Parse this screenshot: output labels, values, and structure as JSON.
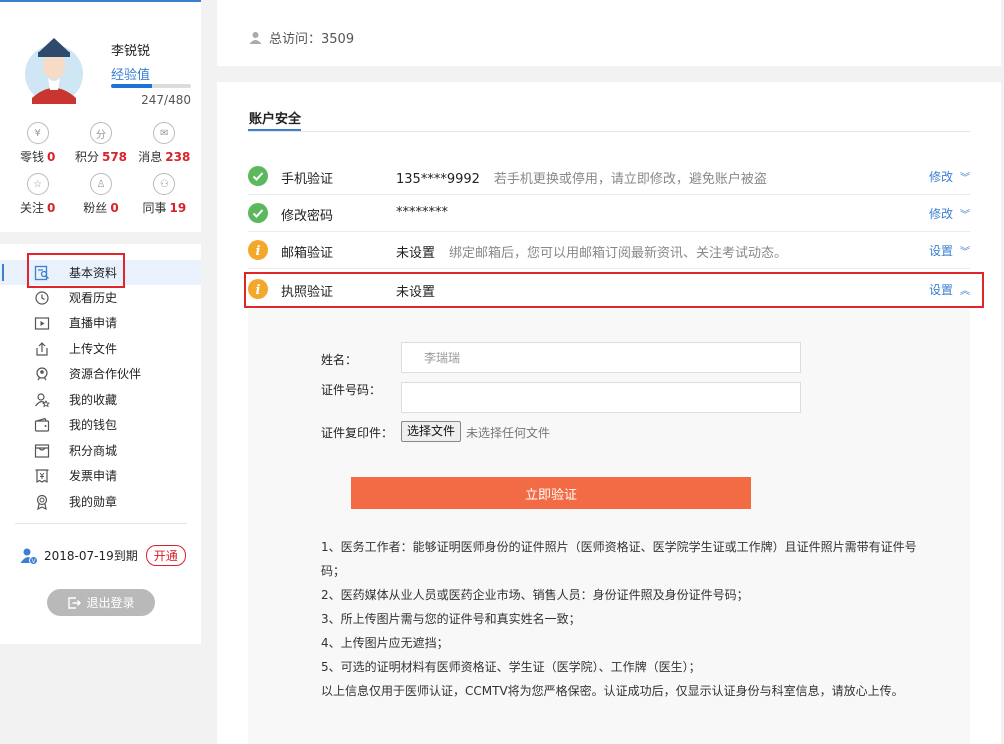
{
  "profile": {
    "name": "李锐锐",
    "exp_label": "经验值",
    "exp_current": 247,
    "exp_max": 480,
    "exp_text": "247/480",
    "stats": [
      {
        "label": "零钱",
        "value": "0",
        "icon": "coin-icon"
      },
      {
        "label": "积分",
        "value": "578",
        "icon": "points-icon"
      },
      {
        "label": "消息",
        "value": "238",
        "icon": "mail-icon"
      },
      {
        "label": "关注",
        "value": "0",
        "icon": "star-icon"
      },
      {
        "label": "粉丝",
        "value": "0",
        "icon": "fans-icon"
      },
      {
        "label": "同事",
        "value": "19",
        "icon": "colleagues-icon"
      }
    ]
  },
  "menu": {
    "items": [
      {
        "label": "基本资料",
        "icon": "profile-card-icon",
        "active": true
      },
      {
        "label": "观看历史",
        "icon": "history-icon"
      },
      {
        "label": "直播申请",
        "icon": "live-icon"
      },
      {
        "label": "上传文件",
        "icon": "upload-icon"
      },
      {
        "label": "资源合作伙伴",
        "icon": "partner-icon"
      },
      {
        "label": "我的收藏",
        "icon": "favorite-icon"
      },
      {
        "label": "我的钱包",
        "icon": "wallet-icon"
      },
      {
        "label": "积分商城",
        "icon": "shop-icon"
      },
      {
        "label": "发票申请",
        "icon": "invoice-icon"
      },
      {
        "label": "我的勋章",
        "icon": "medal-icon"
      }
    ],
    "expire_text": "2018-07-19到期",
    "open_label": "开通",
    "logout_label": "退出登录"
  },
  "visits": {
    "text": "总访问：3509"
  },
  "security": {
    "title": "账户安全",
    "rows": [
      {
        "name": "手机验证",
        "value": "135****9992",
        "tip": "若手机更换或停用，请立即修改，避免账户被盗",
        "action": "修改",
        "status": "ok"
      },
      {
        "name": "修改密码",
        "value": "********",
        "tip": "",
        "action": "修改",
        "status": "ok"
      },
      {
        "name": "邮箱验证",
        "value": "未设置",
        "tip": "绑定邮箱后，您可以用邮箱订阅最新资讯、关注考试动态。",
        "action": "设置",
        "status": "warn"
      },
      {
        "name": "执照验证",
        "value": "未设置",
        "tip": "",
        "action": "设置",
        "status": "warn"
      }
    ]
  },
  "license_form": {
    "name_label": "姓名：",
    "name_value": "李瑞瑞",
    "id_label": "证件号码：",
    "id_value": "",
    "copy_label": "证件复印件：",
    "file_button": "选择文件",
    "file_none": "未选择任何文件",
    "submit_label": "立即验证",
    "notes": [
      "1、医务工作者：能够证明医师身份的证件照片（医师资格证、医学院学生证或工作牌）且证件照片需带有证件号码；",
      "2、医药媒体从业人员或医药企业市场、销售人员：身份证件照及身份证件号码；",
      "3、所上传图片需与您的证件号和真实姓名一致；",
      "4、上传图片应无遮挡；",
      "5、可选的证明材料有医师资格证、学生证（医学院）、工作牌（医生）；",
      "以上信息仅用于医师认证，CCMTV将为您严格保密。认证成功后，仅显示认证身份与科室信息，请放心上传。"
    ]
  },
  "colors": {
    "accent": "#3a7fd0",
    "highlight_red": "#d8232a",
    "ok_green": "#5cb85c",
    "warn_orange": "#f3a72b",
    "submit_orange": "#f26b45"
  }
}
